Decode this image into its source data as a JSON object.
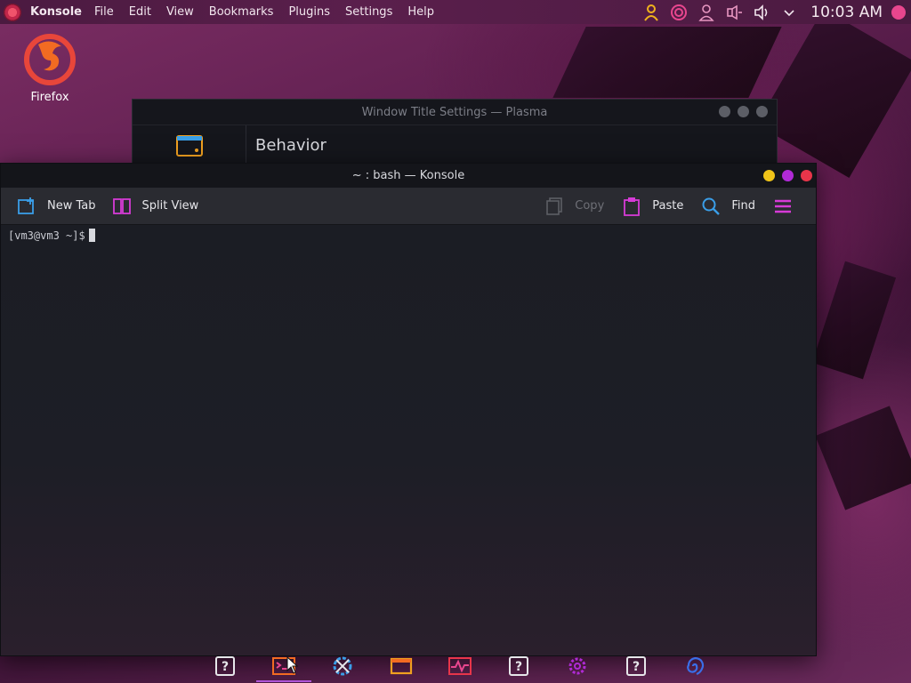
{
  "top_panel": {
    "app_name": "Konsole",
    "menus": [
      "File",
      "Edit",
      "View",
      "Bookmarks",
      "Plugins",
      "Settings",
      "Help"
    ],
    "tray_icons": [
      "user-icon",
      "swirl-icon",
      "person-icon",
      "microphone-muted-icon",
      "volume-icon",
      "chevron-down-icon"
    ],
    "clock": "10:03 AM"
  },
  "desktop": {
    "icons": [
      {
        "label": "Firefox",
        "icon": "firefox-icon"
      }
    ]
  },
  "bg_window": {
    "title": "Window Title Settings — Plasma",
    "heading": "Behavior"
  },
  "konsole": {
    "title": "~ : bash — Konsole",
    "toolbar": {
      "new_tab": "New Tab",
      "split_view": "Split View",
      "copy": "Copy",
      "paste": "Paste",
      "find": "Find"
    },
    "prompt": "[vm3@vm3 ~]$",
    "colors": {
      "minimize": "#f0c419",
      "maximize": "#b02ad6",
      "close": "#e8354a"
    }
  },
  "taskbar": {
    "items": [
      "unknown-app-icon",
      "konsole-icon",
      "settings-tool-icon",
      "window-icon",
      "system-monitor-icon",
      "unknown-app-icon",
      "gear-icon",
      "unknown-app-icon",
      "spiral-icon"
    ],
    "active_index": 1
  }
}
